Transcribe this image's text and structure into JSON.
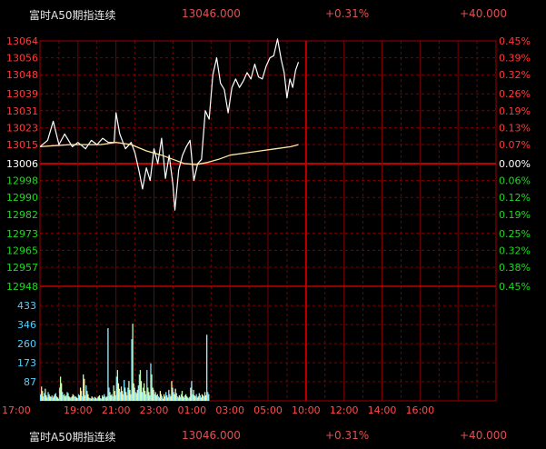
{
  "header": {
    "name": "富时A50期指连续",
    "price": "13046.000",
    "change_pct": "+0.31%",
    "change": "+40.000"
  },
  "footer": {
    "name": "富时A50期指连续",
    "price": "13046.000",
    "change_pct": "+0.31%",
    "change": "+40.000"
  },
  "colors": {
    "background": "#000000",
    "grid": "#7a0000",
    "up": "#ff3b3b",
    "down": "#22d622",
    "neutral": "#ffffff",
    "price_line": "#ffffff",
    "avg_line": "#ffe7a8",
    "volume_axis": "#4fd0ff",
    "time_axis": "#ff4d4d"
  },
  "chart_data": [
    {
      "type": "line",
      "title": "",
      "xlabel": "",
      "ylabel": "",
      "prev_close": 13006,
      "ylim": [
        12948,
        13064
      ],
      "y_ticks": [
        {
          "value": 13064,
          "label": "13064",
          "pct": "0.45%",
          "side": "up"
        },
        {
          "value": 13056,
          "label": "13056",
          "pct": "0.39%",
          "side": "up"
        },
        {
          "value": 13048,
          "label": "13048",
          "pct": "0.32%",
          "side": "up"
        },
        {
          "value": 13039,
          "label": "13039",
          "pct": "0.26%",
          "side": "up"
        },
        {
          "value": 13031,
          "label": "13031",
          "pct": "0.19%",
          "side": "up"
        },
        {
          "value": 13023,
          "label": "13023",
          "pct": "0.13%",
          "side": "up"
        },
        {
          "value": 13015,
          "label": "13015",
          "pct": "0.07%",
          "side": "up"
        },
        {
          "value": 13006,
          "label": "13006",
          "pct": "0.00%",
          "side": "flat"
        },
        {
          "value": 12998,
          "label": "12998",
          "pct": "0.06%",
          "side": "down"
        },
        {
          "value": 12990,
          "label": "12990",
          "pct": "0.12%",
          "side": "down"
        },
        {
          "value": 12982,
          "label": "12982",
          "pct": "0.19%",
          "side": "down"
        },
        {
          "value": 12973,
          "label": "12973",
          "pct": "0.25%",
          "side": "down"
        },
        {
          "value": 12965,
          "label": "12965",
          "pct": "0.32%",
          "side": "down"
        },
        {
          "value": 12957,
          "label": "12957",
          "pct": "0.38%",
          "side": "down"
        },
        {
          "value": 12948,
          "label": "12948",
          "pct": "0.45%",
          "side": "down"
        }
      ],
      "x_range_hours": [
        17,
        41
      ],
      "x_ticks": [
        {
          "h": 17,
          "label": "17:00"
        },
        {
          "h": 19,
          "label": "19:00"
        },
        {
          "h": 21,
          "label": "21:00"
        },
        {
          "h": 23,
          "label": "23:00"
        },
        {
          "h": 25,
          "label": "01:00"
        },
        {
          "h": 27,
          "label": "03:00"
        },
        {
          "h": 29,
          "label": "05:00"
        },
        {
          "h": 31,
          "label": "10:00"
        },
        {
          "h": 33,
          "label": "12:00"
        },
        {
          "h": 35,
          "label": "14:00"
        },
        {
          "h": 37,
          "label": "16:00"
        }
      ],
      "series": [
        {
          "key": "price",
          "x_hours": [
            17.0,
            17.4,
            17.7,
            18.0,
            18.3,
            18.7,
            19.0,
            19.4,
            19.7,
            20.0,
            20.3,
            20.6,
            20.9,
            21.0,
            21.2,
            21.5,
            21.8,
            22.0,
            22.2,
            22.4,
            22.6,
            22.8,
            23.0,
            23.2,
            23.4,
            23.6,
            23.8,
            24.0,
            24.1,
            24.3,
            24.5,
            24.7,
            24.9,
            25.1,
            25.3,
            25.5,
            25.7,
            25.9,
            26.1,
            26.3,
            26.5,
            26.7,
            26.9,
            27.1,
            27.3,
            27.5,
            27.7,
            27.9,
            28.1,
            28.3,
            28.5,
            28.7,
            28.9,
            29.1,
            29.3,
            29.5,
            29.7,
            29.85,
            30.0,
            30.15,
            30.3,
            30.45,
            30.6
          ],
          "y": [
            13014,
            13017,
            13026,
            13015,
            13020,
            13014,
            13016,
            13013,
            13017,
            13015,
            13018,
            13016,
            13016,
            13030,
            13020,
            13013,
            13016,
            13011,
            13003,
            12994,
            13004,
            12998,
            13013,
            13006,
            13018,
            12999,
            13010,
            12996,
            12984,
            13003,
            13010,
            13014,
            13017,
            12998,
            13006,
            13008,
            13031,
            13027,
            13048,
            13056,
            13044,
            13041,
            13030,
            13042,
            13046,
            13042,
            13045,
            13049,
            13046,
            13053,
            13047,
            13046,
            13052,
            13056,
            13057,
            13065,
            13055,
            13049,
            13037,
            13046,
            13042,
            13050,
            13054
          ]
        },
        {
          "key": "average",
          "x_hours": [
            17.0,
            17.8,
            18.6,
            19.4,
            20.2,
            21.0,
            21.8,
            22.6,
            23.4,
            24.0,
            24.6,
            25.2,
            25.8,
            26.4,
            27.0,
            27.8,
            28.6,
            29.4,
            30.2,
            30.6
          ],
          "y": [
            13014,
            13014.5,
            13015,
            13015,
            13015,
            13016,
            13015,
            13012,
            13010,
            13008,
            13006,
            13005.5,
            13006.5,
            13008,
            13010,
            13011,
            13012,
            13013,
            13014,
            13015
          ]
        }
      ]
    },
    {
      "type": "bar",
      "title": "",
      "xlabel": "",
      "ylabel": "",
      "ylim": [
        0,
        520
      ],
      "y_ticks": [
        433,
        346,
        260,
        173,
        87
      ],
      "x_range_hours": [
        17,
        41
      ],
      "x_ticks_shared": true,
      "x_start_hour": 17.0,
      "x_step_hours": 0.05,
      "values": [
        30,
        65,
        45,
        20,
        35,
        55,
        25,
        15,
        40,
        30,
        20,
        18,
        25,
        15,
        22,
        30,
        35,
        20,
        15,
        10,
        60,
        110,
        80,
        40,
        25,
        30,
        20,
        25,
        40,
        35,
        20,
        15,
        15,
        20,
        30,
        25,
        18,
        20,
        15,
        12,
        30,
        25,
        60,
        45,
        20,
        120,
        100,
        25,
        70,
        45,
        30,
        15,
        12,
        10,
        20,
        15,
        10,
        18,
        14,
        10,
        15,
        20,
        25,
        12,
        10,
        25,
        18,
        30,
        20,
        15,
        20,
        330,
        60,
        40,
        25,
        30,
        20,
        70,
        45,
        25,
        110,
        140,
        80,
        55,
        40,
        65,
        45,
        30,
        95,
        60,
        40,
        25,
        60,
        90,
        50,
        30,
        280,
        350,
        80,
        60,
        40,
        35,
        50,
        70,
        120,
        140,
        90,
        40,
        60,
        80,
        45,
        30,
        140,
        60,
        40,
        25,
        170,
        120,
        60,
        50,
        30,
        40,
        25,
        30,
        20,
        15,
        45,
        30,
        20,
        10,
        30,
        20,
        40,
        25,
        15,
        50,
        30,
        20,
        90,
        60,
        40,
        30,
        55,
        35,
        20,
        15,
        25,
        18,
        30,
        45,
        20,
        15,
        25,
        30,
        20,
        15,
        12,
        18,
        60,
        90,
        30,
        50,
        25,
        20,
        30,
        15,
        20,
        35,
        25,
        15,
        30,
        25,
        20,
        40,
        25,
        300,
        40,
        30
      ]
    }
  ]
}
